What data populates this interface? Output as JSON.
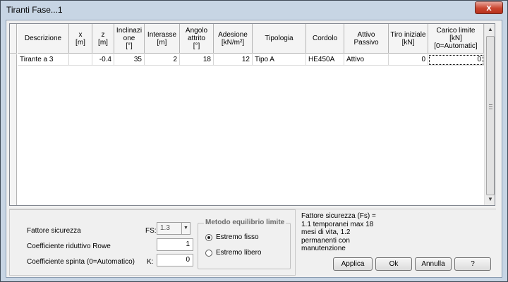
{
  "window": {
    "title": "Tiranti Fase...1",
    "close": "x"
  },
  "grid": {
    "headers": [
      "Descrizione",
      "x\n[m]",
      "z\n[m]",
      "Inclinazi\none\n[°]",
      "Interasse\n[m]",
      "Angolo\nattrito\n[°]",
      "Adesione\n[kN/m²]",
      "Tipologia",
      "Cordolo",
      "Attivo\nPassivo",
      "Tiro iniziale\n[kN]",
      "Carico limite\n[kN]\n[0=Automatic]"
    ],
    "rows": [
      [
        "Tirante a 3",
        "",
        "-0.4",
        "35",
        "2",
        "18",
        "12",
        "Tipo A",
        "HE450A",
        "Attivo",
        "0",
        "0"
      ]
    ]
  },
  "form": {
    "fattore_label": "Fattore sicurezza",
    "fs_label": "FS:",
    "fs_value": "1.3",
    "rowe_label": "Coefficiente riduttivo Rowe",
    "rowe_value": "1",
    "spinta_label": "Coefficiente spinta (0=Automatico)",
    "k_label": "K:",
    "k_value": "0",
    "metodo_title": "Metodo equilibrio limite",
    "option_fisso": "Estremo fisso",
    "option_libero": "Estremo libero",
    "selected": "Estremo fisso"
  },
  "info": "Fattore sicurezza (Fs) =\n1.1 temporanei max 18\nmesi di vita, 1.2\npermanenti con\nmanutenzione",
  "buttons": {
    "applica": "Applica",
    "ok": "Ok",
    "annulla": "Annulla",
    "help": "?"
  }
}
